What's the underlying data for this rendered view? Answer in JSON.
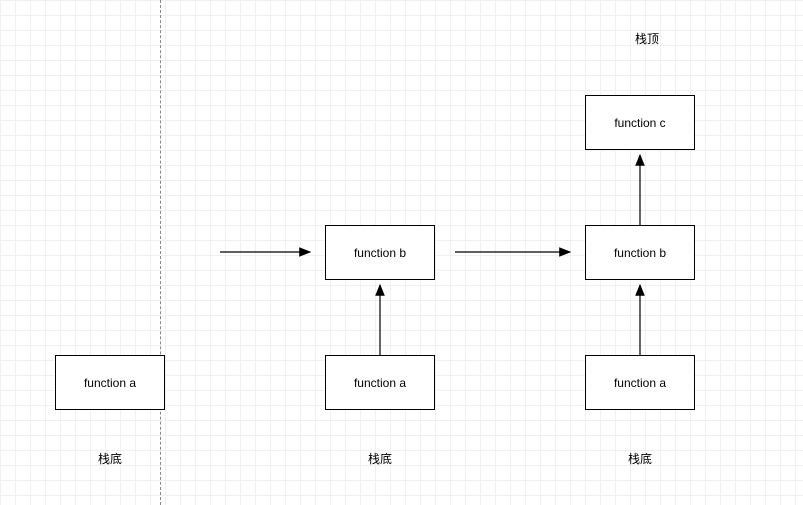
{
  "diagram": {
    "topLabel": "栈顶",
    "bottomLabels": [
      "栈底",
      "栈底",
      "栈底"
    ],
    "stacks": [
      {
        "boxes": [
          {
            "label": "function a"
          }
        ]
      },
      {
        "boxes": [
          {
            "label": "function a"
          },
          {
            "label": "function b"
          }
        ]
      },
      {
        "boxes": [
          {
            "label": "function a"
          },
          {
            "label": "function b"
          },
          {
            "label": "function c"
          }
        ]
      }
    ]
  }
}
